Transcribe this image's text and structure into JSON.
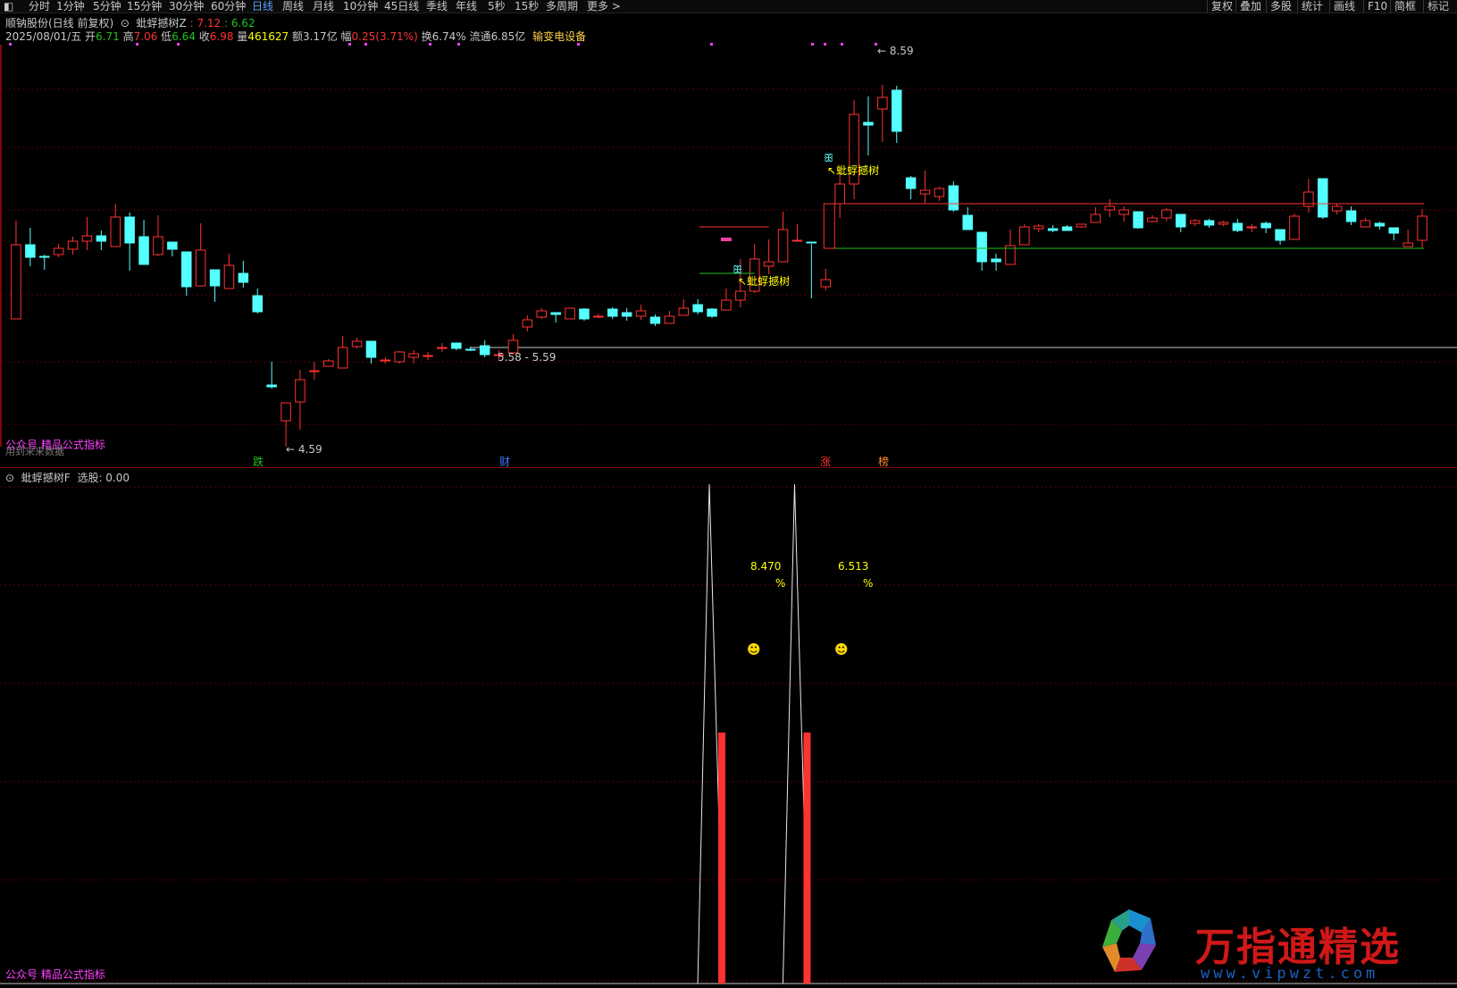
{
  "toolbar": {
    "menu_icon": "window-icon",
    "periods": [
      "分时",
      "1分钟",
      "5分钟",
      "15分钟",
      "30分钟",
      "60分钟",
      "日线",
      "周线",
      "月线",
      "10分钟",
      "45日线",
      "季线",
      "年线",
      "5秒",
      "15秒",
      "多周期",
      "更多 >"
    ],
    "active_period": "日线",
    "right_items": [
      "复权",
      "叠加",
      "多股",
      "统计",
      "画线",
      "F10",
      "简框",
      "标记"
    ]
  },
  "main_panel": {
    "stock_name": "顺钠股份(日线 前复权)",
    "indicator_name": "蚍蜉撼树Z",
    "indicator_v1": ": 7.12",
    "indicator_v2": ": 6.62",
    "info": {
      "date": "2025/08/01/五",
      "open_label": "开",
      "open": "6.71",
      "high_label": "高",
      "high": "7.06",
      "low_label": "低",
      "low": "6.64",
      "close_label": "收",
      "close": "6.98",
      "vol_label": "量",
      "vol": "461627",
      "amt_label": "额",
      "amt": "3.17亿",
      "chg_label": "幅",
      "chg": "0.25(3.71%)",
      "turn_label": "换",
      "turn": "6.74%",
      "float_label": "流通",
      "float": "6.85亿",
      "sector": "输变电设备"
    },
    "annotations": {
      "high_price": "8.59",
      "low_price": "4.59",
      "range_label": "5.58 - 5.59",
      "signal_text": "蚍蜉撼树",
      "watermark1": "公众号 精品公式指标",
      "watermark2": "用到来来数据"
    },
    "markers": [
      {
        "text": "跌",
        "color": "#20c020"
      },
      {
        "text": "财",
        "color": "#3a7aff"
      },
      {
        "text": "涨",
        "color": "#ff3030"
      },
      {
        "text": "榜",
        "color": "#ff8a2a"
      }
    ]
  },
  "sub_panel": {
    "indicator_name": "蚍蜉撼树F",
    "select_label": "选股: 0.00",
    "values": [
      {
        "pct": "8.470",
        "sign": "%"
      },
      {
        "pct": "6.513",
        "sign": "%"
      }
    ],
    "smile_icon": "smiley-icon",
    "watermark": "公众号 精品公式指标"
  },
  "colors": {
    "up": "#ff3232",
    "down": "#54ffff",
    "yellow": "#ffff00",
    "magenta": "#ff40ff",
    "grid": "#5a0000",
    "green_line": "#20c020"
  },
  "brand": {
    "name": "万指通精选",
    "url": "www.vipwzt.com"
  },
  "chart_data": {
    "type": "candlestick",
    "series": [
      {
        "name": "k",
        "values": [
          [
            5.83,
            6.66,
            5.83,
            6.93
          ],
          [
            6.66,
            6.52,
            6.42,
            6.85
          ],
          [
            6.53,
            6.52,
            6.38,
            6.55
          ],
          [
            6.55,
            6.62,
            6.52,
            6.67
          ],
          [
            6.61,
            6.7,
            6.55,
            6.75
          ],
          [
            6.7,
            6.76,
            6.6,
            6.97
          ],
          [
            6.76,
            6.7,
            6.6,
            6.82
          ],
          [
            6.64,
            6.97,
            6.64,
            7.12
          ],
          [
            6.97,
            6.68,
            6.37,
            7.02
          ],
          [
            6.75,
            6.44,
            6.44,
            6.94
          ],
          [
            6.55,
            6.75,
            6.53,
            6.99
          ],
          [
            6.69,
            6.61,
            6.53,
            6.69
          ],
          [
            6.58,
            6.19,
            6.09,
            6.58
          ],
          [
            6.2,
            6.6,
            6.2,
            6.9
          ],
          [
            6.38,
            6.2,
            6.02,
            6.38
          ],
          [
            6.17,
            6.43,
            6.17,
            6.56
          ],
          [
            6.34,
            6.24,
            6.18,
            6.48
          ],
          [
            6.09,
            5.91,
            5.89,
            6.17
          ],
          [
            5.09,
            5.07,
            5.05,
            5.35
          ],
          [
            4.69,
            4.89,
            4.4,
            4.89
          ],
          [
            4.9,
            5.15,
            4.59,
            5.26
          ],
          [
            5.25,
            5.25,
            5.15,
            5.35
          ],
          [
            5.3,
            5.36,
            5.3,
            5.38
          ],
          [
            5.28,
            5.51,
            5.28,
            5.64
          ],
          [
            5.52,
            5.58,
            5.5,
            5.62
          ],
          [
            5.58,
            5.4,
            5.33,
            5.58
          ],
          [
            5.37,
            5.37,
            5.33,
            5.4
          ],
          [
            5.35,
            5.46,
            5.33,
            5.47
          ],
          [
            5.4,
            5.44,
            5.33,
            5.48
          ],
          [
            5.42,
            5.42,
            5.37,
            5.46
          ],
          [
            5.5,
            5.51,
            5.46,
            5.56
          ],
          [
            5.56,
            5.5,
            5.48,
            5.56
          ],
          [
            5.49,
            5.48,
            5.47,
            5.52
          ],
          [
            5.53,
            5.43,
            5.4,
            5.59
          ],
          [
            5.43,
            5.43,
            5.38,
            5.48
          ],
          [
            5.45,
            5.59,
            5.43,
            5.66
          ],
          [
            5.74,
            5.82,
            5.69,
            5.87
          ],
          [
            5.85,
            5.92,
            5.83,
            5.95
          ],
          [
            5.9,
            5.88,
            5.79,
            5.9
          ],
          [
            5.83,
            5.95,
            5.83,
            5.95
          ],
          [
            5.94,
            5.83,
            5.81,
            5.95
          ],
          [
            5.86,
            5.86,
            5.84,
            5.89
          ],
          [
            5.94,
            5.86,
            5.83,
            5.96
          ],
          [
            5.9,
            5.86,
            5.81,
            5.95
          ],
          [
            5.86,
            5.92,
            5.82,
            5.99
          ],
          [
            5.85,
            5.78,
            5.75,
            5.88
          ],
          [
            5.78,
            5.86,
            5.78,
            5.92
          ],
          [
            5.87,
            5.95,
            5.87,
            6.05
          ],
          [
            5.99,
            5.91,
            5.88,
            6.05
          ],
          [
            5.94,
            5.86,
            5.84,
            5.95
          ],
          [
            5.93,
            6.04,
            5.93,
            6.17
          ],
          [
            6.04,
            6.14,
            5.96,
            6.5
          ],
          [
            6.14,
            6.5,
            6.12,
            6.67
          ],
          [
            6.42,
            6.47,
            6.33,
            6.72
          ],
          [
            6.47,
            6.83,
            6.47,
            7.03
          ],
          [
            6.71,
            6.71,
            6.71,
            6.89
          ],
          [
            6.69,
            6.68,
            6.06,
            6.67
          ],
          [
            6.19,
            6.27,
            6.15,
            6.39
          ],
          [
            7.12,
            7.34,
            6.96,
            7.52
          ],
          [
            7.34,
            8.12,
            7.17,
            8.28
          ],
          [
            8.03,
            8.0,
            7.66,
            8.32
          ],
          [
            8.18,
            8.31,
            7.81,
            8.45
          ],
          [
            8.39,
            7.93,
            7.8,
            8.44
          ],
          [
            7.41,
            7.29,
            7.17,
            7.43
          ],
          [
            7.23,
            7.27,
            7.12,
            7.49
          ],
          [
            7.2,
            7.29,
            7.15,
            7.31
          ],
          [
            7.32,
            7.05,
            7.03,
            7.37
          ],
          [
            6.99,
            6.83,
            6.83,
            7.08
          ],
          [
            6.8,
            6.47,
            6.37,
            6.8
          ],
          [
            6.5,
            6.47,
            6.37,
            6.56
          ],
          [
            6.44,
            6.65,
            6.44,
            6.83
          ],
          [
            6.66,
            6.86,
            6.66,
            6.89
          ],
          [
            6.84,
            6.87,
            6.8,
            6.89
          ],
          [
            6.84,
            6.82,
            6.8,
            6.88
          ],
          [
            6.86,
            6.82,
            6.82,
            6.88
          ],
          [
            6.86,
            6.89,
            6.85,
            6.89
          ],
          [
            6.91,
            7.0,
            6.91,
            7.08
          ],
          [
            7.05,
            7.09,
            6.97,
            7.17
          ],
          [
            7.0,
            7.05,
            6.92,
            7.09
          ],
          [
            7.03,
            6.85,
            6.84,
            7.03
          ],
          [
            6.92,
            6.96,
            6.91,
            6.99
          ],
          [
            6.96,
            7.05,
            6.92,
            7.07
          ],
          [
            7.0,
            6.86,
            6.8,
            7.0
          ],
          [
            6.9,
            6.93,
            6.87,
            6.95
          ],
          [
            6.93,
            6.88,
            6.85,
            6.95
          ],
          [
            6.89,
            6.91,
            6.87,
            6.93
          ],
          [
            6.9,
            6.82,
            6.8,
            6.95
          ],
          [
            6.85,
            6.86,
            6.8,
            6.89
          ],
          [
            6.9,
            6.85,
            6.79,
            6.92
          ],
          [
            6.83,
            6.71,
            6.66,
            6.83
          ],
          [
            6.72,
            6.98,
            6.72,
            7.01
          ],
          [
            7.09,
            7.25,
            7.02,
            7.4
          ],
          [
            7.4,
            6.97,
            6.95,
            7.4
          ],
          [
            7.04,
            7.09,
            7.0,
            7.12
          ],
          [
            7.04,
            6.92,
            6.88,
            7.09
          ],
          [
            6.86,
            6.93,
            6.86,
            6.96
          ],
          [
            6.9,
            6.87,
            6.83,
            6.92
          ],
          [
            6.85,
            6.79,
            6.71,
            6.85
          ],
          [
            6.64,
            6.68,
            6.64,
            6.83
          ],
          [
            6.71,
            6.98,
            6.63,
            7.06
          ]
        ]
      },
      {
        "name": "选股",
        "values": [
          0,
          0,
          0,
          0,
          0,
          0,
          0,
          0,
          0,
          0,
          0,
          0,
          0,
          0,
          0,
          0,
          0,
          0,
          0,
          0,
          0,
          0,
          0,
          0,
          0,
          0,
          0,
          0,
          0,
          0,
          0,
          0,
          0,
          0,
          0,
          0,
          0,
          0,
          0,
          0,
          0,
          0,
          0,
          0,
          0,
          0,
          0,
          0,
          0,
          0,
          0,
          0,
          0,
          0,
          0,
          0,
          0,
          0,
          0,
          0,
          0,
          0,
          0,
          0,
          0,
          0,
          0,
          0,
          0,
          0,
          0,
          0,
          0,
          0,
          0,
          0,
          0,
          0,
          0,
          0,
          0,
          0,
          0,
          0,
          0,
          0,
          0,
          0,
          0,
          0,
          0,
          0,
          0,
          0,
          0,
          0,
          0,
          0,
          0,
          0
        ]
      }
    ],
    "ylim": [
      4.4,
      8.9
    ],
    "box": {
      "top": 6.62,
      "bottom": 7.12
    },
    "peaks_index": [
      49,
      55
    ],
    "peak_values": [
      8.47,
      6.513
    ],
    "grid": true
  }
}
